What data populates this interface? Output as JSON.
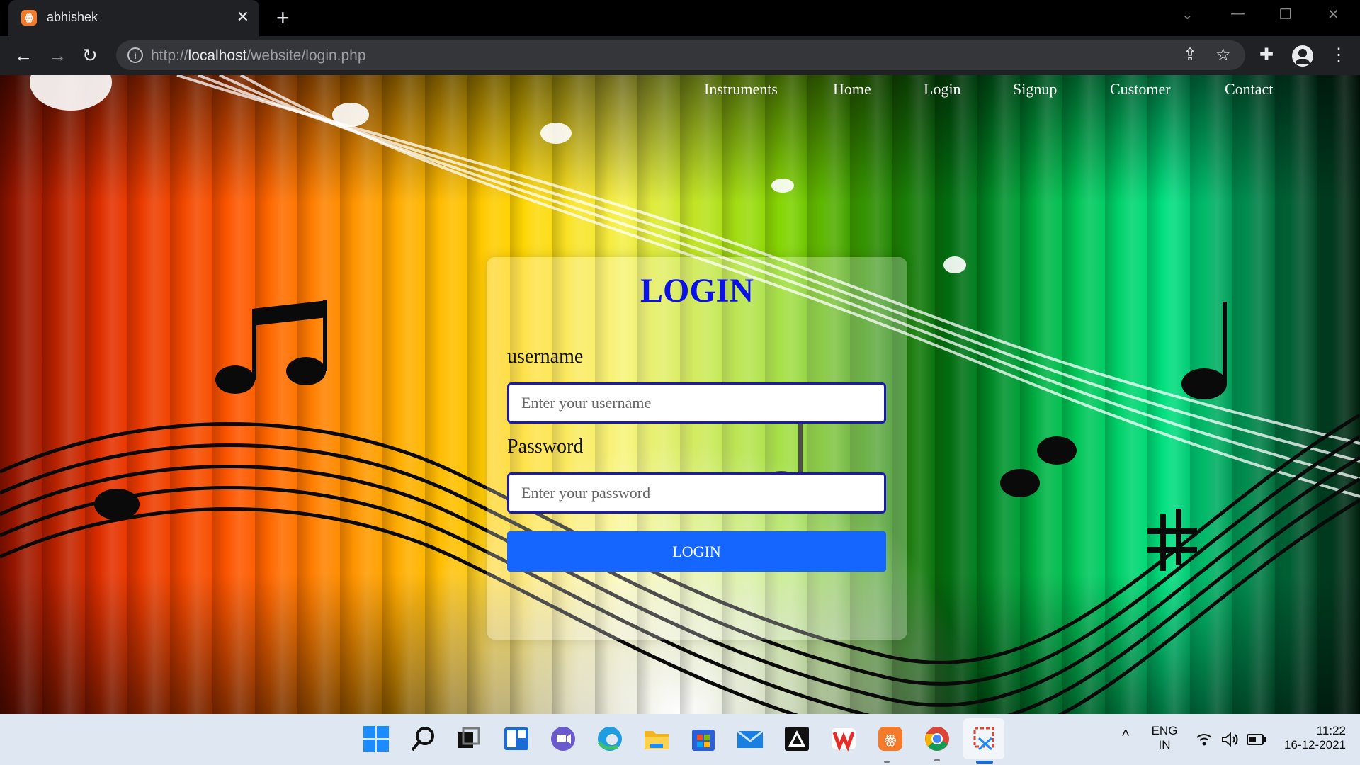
{
  "browser": {
    "tab_title": "abhishek",
    "tab_favicon_text": "ꙮ",
    "new_tab_glyph": "+",
    "close_tab_glyph": "✕",
    "url_scheme": "http://",
    "url_host": "localhost",
    "url_path": "/website/login.php"
  },
  "nav": {
    "items": [
      "Instruments",
      "Home",
      "Login",
      "Signup",
      "Customer",
      "Contact"
    ]
  },
  "login": {
    "title": "LOGIN",
    "username_label": "username",
    "username_placeholder": "Enter your username",
    "password_label": "Password",
    "password_placeholder": "Enter your password",
    "submit_label": "LOGIN"
  },
  "taskbar": {
    "apps": [
      "start-icon",
      "search-icon",
      "task-view-icon",
      "widgets-icon",
      "chat-icon",
      "edge-icon",
      "file-explorer-icon",
      "store-icon",
      "mail-icon",
      "inkscape-icon",
      "wps-office-icon",
      "xampp-icon",
      "chrome-icon",
      "snipping-tool-icon"
    ],
    "lang_line1": "ENG",
    "lang_line2": "IN",
    "time": "11:22",
    "date": "16-12-2021"
  },
  "colors": {
    "login_title": "#0b10e8",
    "login_button": "#1466ff",
    "input_border": "#1a1ab0"
  }
}
